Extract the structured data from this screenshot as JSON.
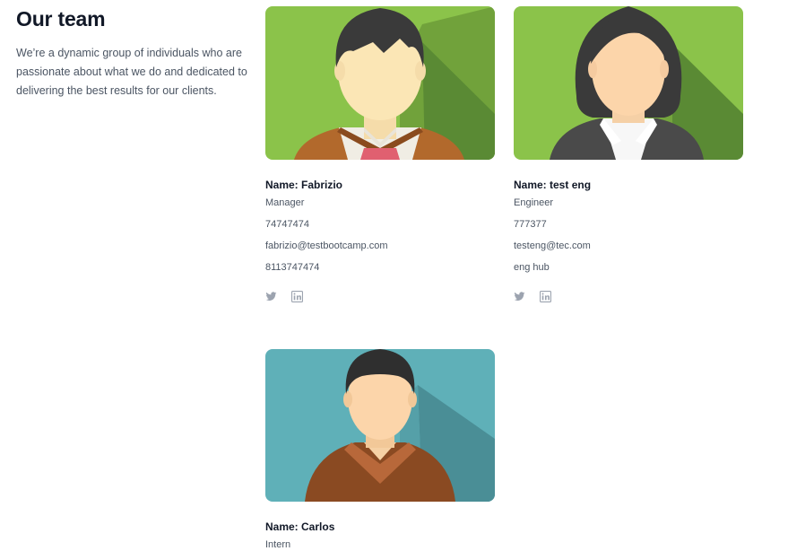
{
  "section": {
    "title": "Our team",
    "description": "We’re a dynamic group of individuals who are passionate about what we do and dedicated to delivering the best results for our clients."
  },
  "members": [
    {
      "name": "Name: Fabrizio",
      "role": "Manager",
      "phone": "74747474",
      "email": "fabrizio@testbootcamp.com",
      "extra": "8113747474"
    },
    {
      "name": "Name: test eng",
      "role": "Engineer",
      "phone": "777377",
      "email": "testeng@tec.com",
      "extra": "eng hub"
    },
    {
      "name": "Name: Carlos",
      "role": "Intern"
    }
  ],
  "icons": {
    "social": [
      "twitter-icon",
      "linkedin-icon"
    ]
  },
  "colors": {
    "green_bg": "#8bc34a",
    "teal_bg": "#5fb0b8",
    "icon_gray": "#9ca3af"
  }
}
